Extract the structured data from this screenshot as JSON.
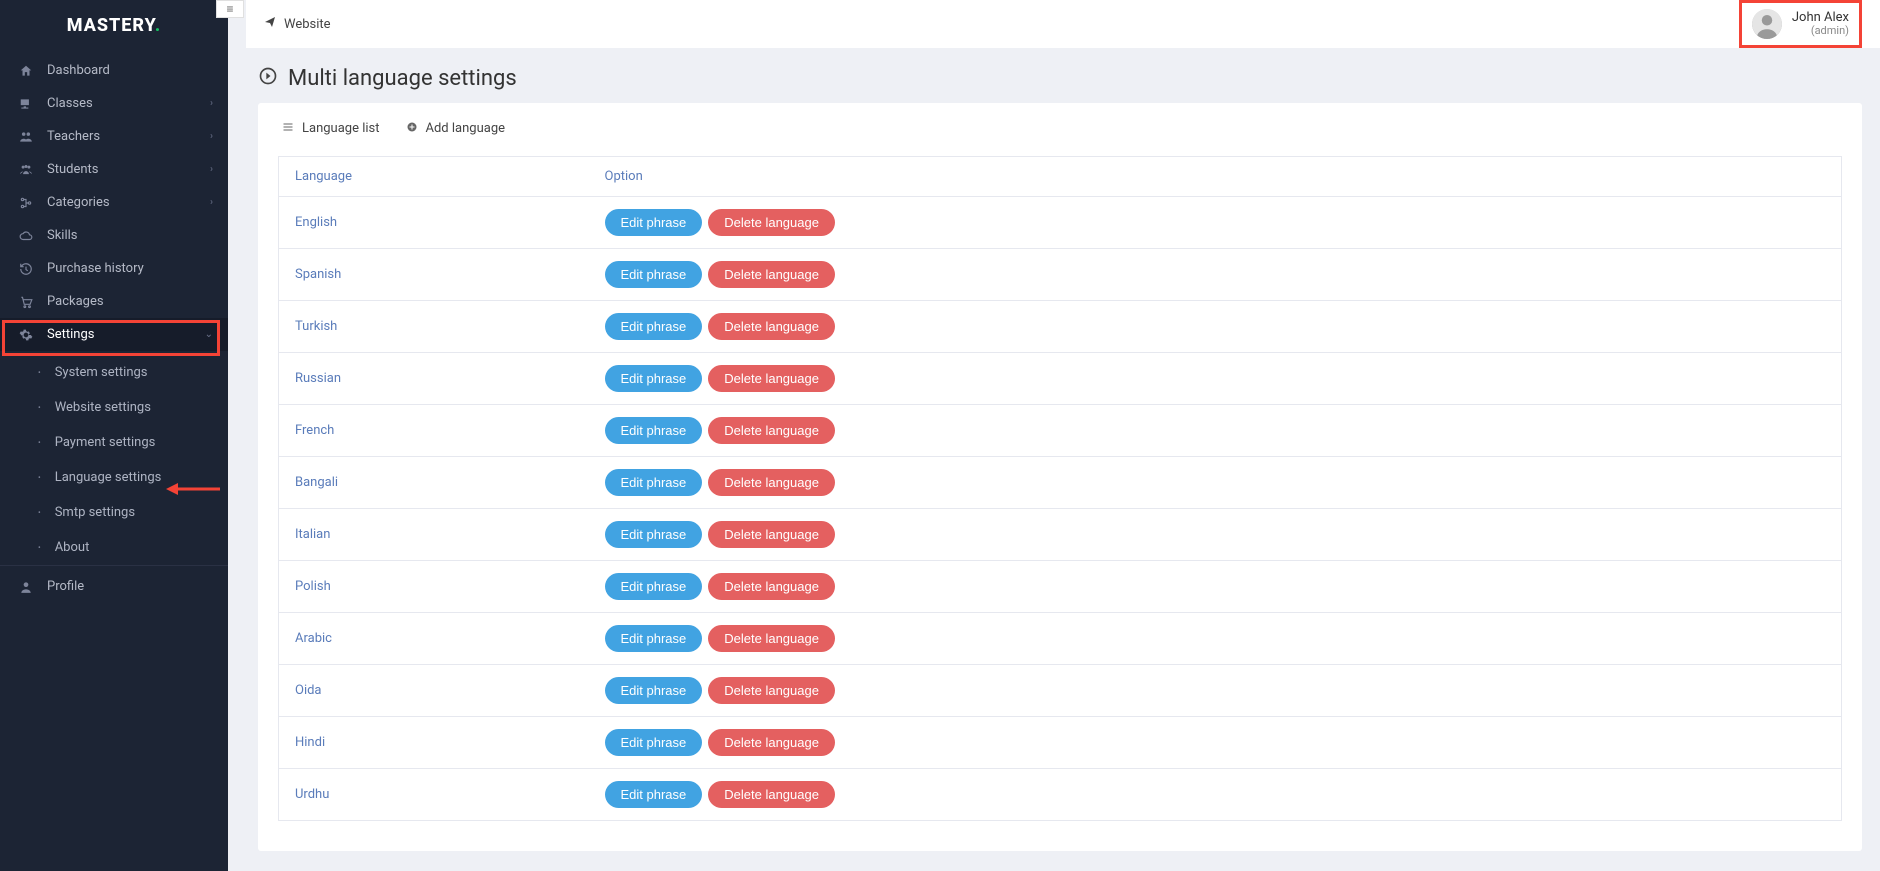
{
  "brand": {
    "name": "MASTERY",
    "dot": "."
  },
  "topbar": {
    "website": "Website"
  },
  "user": {
    "name": "John Alex",
    "role": "(admin)"
  },
  "sidebar": {
    "items": [
      {
        "label": "Dashboard",
        "icon": "🏠",
        "expandable": false
      },
      {
        "label": "Classes",
        "icon": "🖥",
        "expandable": true
      },
      {
        "label": "Teachers",
        "icon": "👥",
        "expandable": true
      },
      {
        "label": "Students",
        "icon": "👨‍👩‍👦",
        "expandable": true
      },
      {
        "label": "Categories",
        "icon": "🔀",
        "expandable": true
      },
      {
        "label": "Skills",
        "icon": "☁",
        "expandable": false
      },
      {
        "label": "Purchase history",
        "icon": "⟲",
        "expandable": false
      },
      {
        "label": "Packages",
        "icon": "🛒",
        "expandable": false
      },
      {
        "label": "Settings",
        "icon": "⚙",
        "expandable": true,
        "active": true
      },
      {
        "label": "Profile",
        "icon": "👤",
        "expandable": false
      }
    ],
    "settings_sub": [
      {
        "label": "System settings"
      },
      {
        "label": "Website settings"
      },
      {
        "label": "Payment settings"
      },
      {
        "label": "Language settings"
      },
      {
        "label": "Smtp settings"
      },
      {
        "label": "About"
      }
    ]
  },
  "page": {
    "title": "Multi language settings"
  },
  "tabs": {
    "list": "Language list",
    "add": "Add language"
  },
  "table": {
    "headers": {
      "language": "Language",
      "option": "Option"
    },
    "actions": {
      "edit": "Edit phrase",
      "delete": "Delete language"
    },
    "rows": [
      {
        "name": "English"
      },
      {
        "name": "Spanish"
      },
      {
        "name": "Turkish"
      },
      {
        "name": "Russian"
      },
      {
        "name": "French"
      },
      {
        "name": "Bangali"
      },
      {
        "name": "Italian"
      },
      {
        "name": "Polish"
      },
      {
        "name": "Arabic"
      },
      {
        "name": "Oida"
      },
      {
        "name": "Hindi"
      },
      {
        "name": "Urdhu"
      }
    ]
  }
}
